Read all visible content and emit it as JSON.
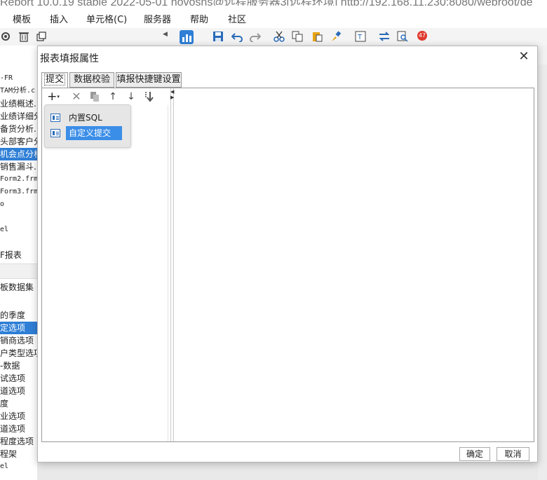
{
  "window": {
    "title": "Report 10.0.19 stable 2022-05-01 novosns@远程服务器3[远程环境]   http://192.168.11.230:8080/webroot/de"
  },
  "menubar": {
    "items": [
      "模板",
      "插入",
      "单元格(C)",
      "服务器",
      "帮助",
      "社区"
    ]
  },
  "toolbar": {
    "badge_count": "47"
  },
  "left_tree": {
    "items_top": [
      "-FR",
      "TAM分析.c",
      "业绩概述.",
      "业绩详细分",
      "备货分析.",
      "头部客户分",
      "机会点分析",
      "销售漏斗.",
      "Form2.frm",
      "Form3.frm",
      "o",
      "",
      "el",
      "",
      "F报表"
    ],
    "items_bottom": [
      "板数据集",
      "",
      "的季度",
      "定选项",
      "销商选项",
      "户类型选项",
      "-数据",
      "试选项",
      "道选项",
      "度",
      "业选项",
      "道选项",
      "程度选项",
      "程架",
      "el"
    ]
  },
  "dialog": {
    "title": "报表填报属性",
    "tabs": [
      "提交",
      "数据校验",
      "填报快捷键设置"
    ],
    "active_tab": 0,
    "toolbar_icons": [
      "add-dropdown-icon",
      "delete-icon",
      "copy-icon",
      "move-up-icon",
      "move-down-icon",
      "move-bottom-icon"
    ],
    "popup_menu": [
      {
        "label": "内置SQL",
        "selected": false
      },
      {
        "label": "自定义提交",
        "selected": true
      }
    ],
    "confirm_label": "确定",
    "cancel_label": "取消"
  },
  "colors": {
    "selection": "#3b8ee8",
    "tree_selection": "#2f7fd6",
    "badge": "#e03a2e"
  }
}
